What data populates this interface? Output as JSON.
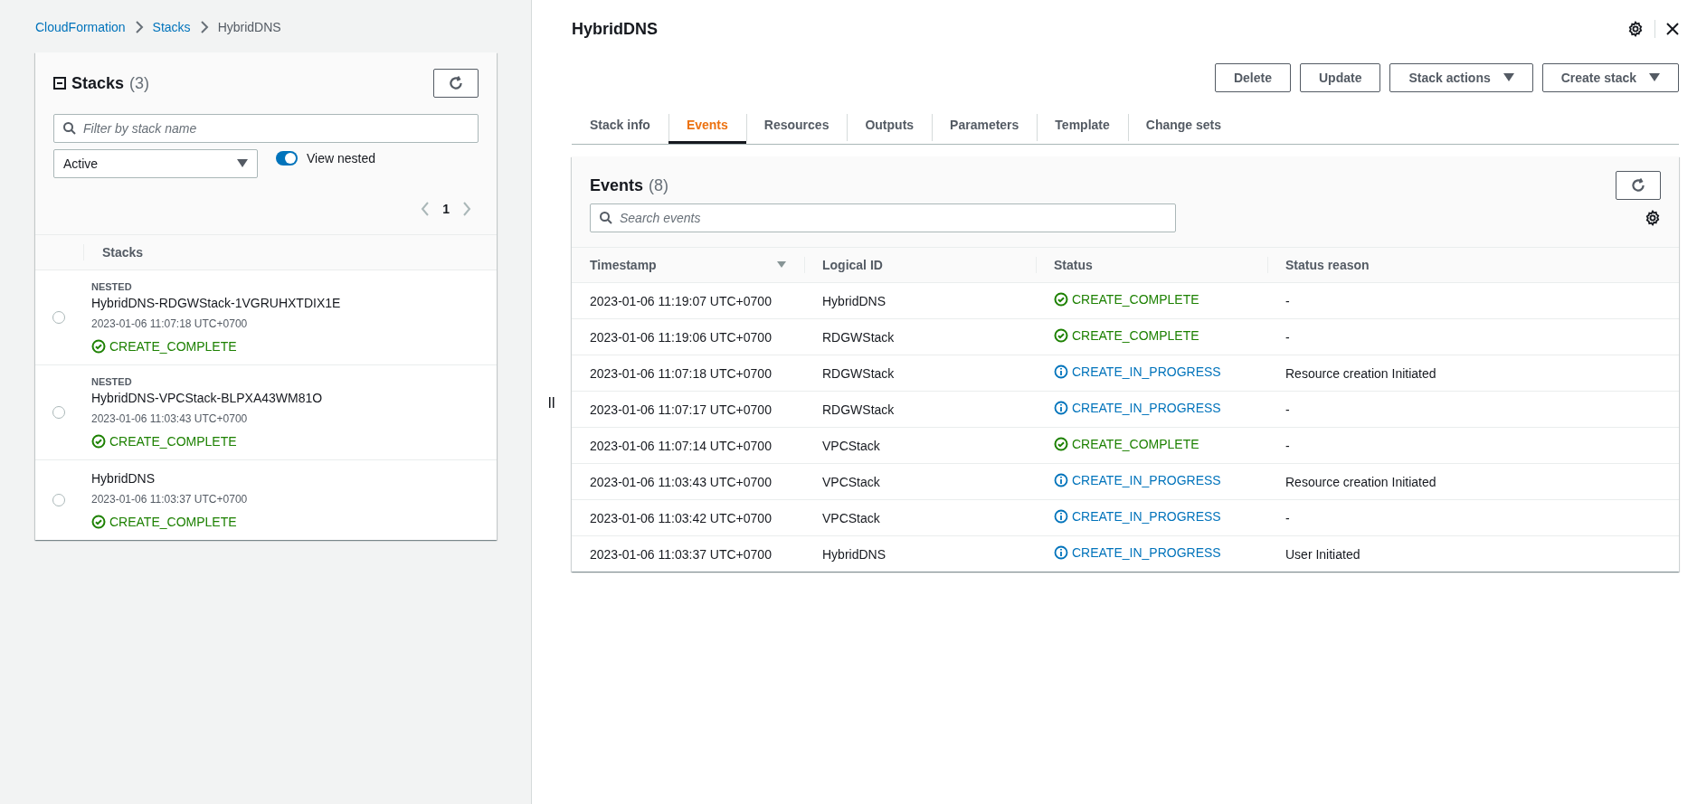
{
  "breadcrumbs": [
    {
      "label": "CloudFormation",
      "link": true
    },
    {
      "label": "Stacks",
      "link": true
    },
    {
      "label": "HybridDNS",
      "link": false
    }
  ],
  "stacks_panel": {
    "title": "Stacks",
    "count": "(3)",
    "filter": {
      "placeholder": "Filter by stack name"
    },
    "status_select": {
      "value": "Active"
    },
    "view_nested": {
      "label": "View nested",
      "on": true
    },
    "pagination": {
      "page": "1"
    },
    "column": "Stacks",
    "items": [
      {
        "badge": "NESTED",
        "name": "HybridDNS-RDGWStack-1VGRUHXTDIX1E",
        "time": "2023-01-06 11:07:18 UTC+0700",
        "status": "CREATE_COMPLETE",
        "kind": "complete",
        "selected": false
      },
      {
        "badge": "NESTED",
        "name": "HybridDNS-VPCStack-BLPXA43WM81O",
        "time": "2023-01-06 11:03:43 UTC+0700",
        "status": "CREATE_COMPLETE",
        "kind": "complete",
        "selected": false
      },
      {
        "name": "HybridDNS",
        "time": "2023-01-06 11:03:37 UTC+0700",
        "status": "CREATE_COMPLETE",
        "kind": "complete",
        "selected": false
      }
    ]
  },
  "detail": {
    "title": "HybridDNS",
    "buttons": [
      {
        "label": "Delete",
        "dropdown": false
      },
      {
        "label": "Update",
        "dropdown": false
      },
      {
        "label": "Stack actions",
        "dropdown": true
      },
      {
        "label": "Create stack",
        "dropdown": true
      }
    ],
    "tabs": [
      {
        "label": "Stack info",
        "selected": false
      },
      {
        "label": "Events",
        "selected": true
      },
      {
        "label": "Resources",
        "selected": false
      },
      {
        "label": "Outputs",
        "selected": false
      },
      {
        "label": "Parameters",
        "selected": false
      },
      {
        "label": "Template",
        "selected": false
      },
      {
        "label": "Change sets",
        "selected": false
      }
    ],
    "events": {
      "title": "Events",
      "count": "(8)",
      "search": {
        "placeholder": "Search events"
      },
      "columns": [
        "Timestamp",
        "Logical ID",
        "Status",
        "Status reason"
      ],
      "rows": [
        {
          "timestamp": "2023-01-06 11:19:07 UTC+0700",
          "logical_id": "HybridDNS",
          "status": "CREATE_COMPLETE",
          "kind": "complete",
          "reason": "-"
        },
        {
          "timestamp": "2023-01-06 11:19:06 UTC+0700",
          "logical_id": "RDGWStack",
          "status": "CREATE_COMPLETE",
          "kind": "complete",
          "reason": "-"
        },
        {
          "timestamp": "2023-01-06 11:07:18 UTC+0700",
          "logical_id": "RDGWStack",
          "status": "CREATE_IN_PROGRESS",
          "kind": "in_progress",
          "reason": "Resource creation Initiated"
        },
        {
          "timestamp": "2023-01-06 11:07:17 UTC+0700",
          "logical_id": "RDGWStack",
          "status": "CREATE_IN_PROGRESS",
          "kind": "in_progress",
          "reason": "-"
        },
        {
          "timestamp": "2023-01-06 11:07:14 UTC+0700",
          "logical_id": "VPCStack",
          "status": "CREATE_COMPLETE",
          "kind": "complete",
          "reason": "-"
        },
        {
          "timestamp": "2023-01-06 11:03:43 UTC+0700",
          "logical_id": "VPCStack",
          "status": "CREATE_IN_PROGRESS",
          "kind": "in_progress",
          "reason": "Resource creation Initiated"
        },
        {
          "timestamp": "2023-01-06 11:03:42 UTC+0700",
          "logical_id": "VPCStack",
          "status": "CREATE_IN_PROGRESS",
          "kind": "in_progress",
          "reason": "-"
        },
        {
          "timestamp": "2023-01-06 11:03:37 UTC+0700",
          "logical_id": "HybridDNS",
          "status": "CREATE_IN_PROGRESS",
          "kind": "in_progress",
          "reason": "User Initiated"
        }
      ]
    }
  }
}
